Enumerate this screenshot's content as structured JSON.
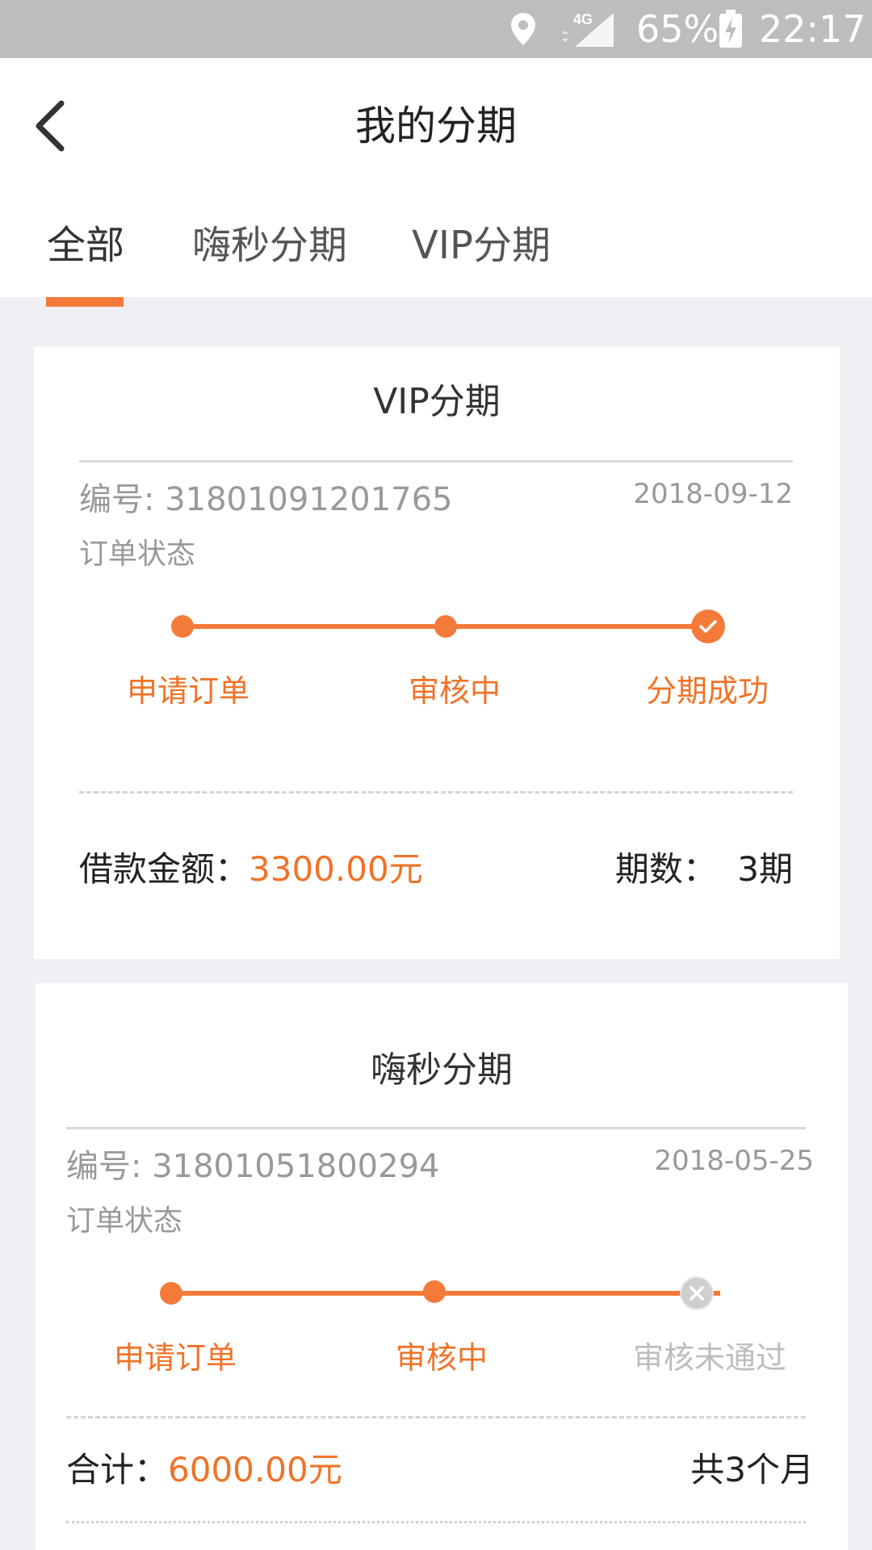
{
  "status_bar": {
    "battery_percent": "65%",
    "time": "22:17",
    "network_label": "4G",
    "icons": [
      "location-icon",
      "signal-4g-icon",
      "battery-charging-icon"
    ]
  },
  "header": {
    "title": "我的分期",
    "back_icon": "chevron-left-icon"
  },
  "tabs": [
    {
      "label": "全部",
      "active": true
    },
    {
      "label": "嗨秒分期",
      "active": false
    },
    {
      "label": "VIP分期",
      "active": false
    }
  ],
  "colors": {
    "accent": "#f47a3a",
    "accent_text": "#f07328",
    "muted": "#999999",
    "disabled": "#bdbdbd"
  },
  "orders": [
    {
      "title": "VIP分期",
      "number": "编号: 31801091201765",
      "date": "2018-09-12",
      "status_label": "订单状态",
      "steps": [
        {
          "label": "申请订单",
          "state": "done"
        },
        {
          "label": "审核中",
          "state": "done"
        },
        {
          "label": "分期成功",
          "state": "success"
        }
      ],
      "amount_label": "借款金额：",
      "amount_value": "3300.00元",
      "term_label": "期数：",
      "term_value": "3期"
    },
    {
      "title": "嗨秒分期",
      "number": "编号: 31801051800294",
      "date": "2018-05-25",
      "status_label": "订单状态",
      "steps": [
        {
          "label": "申请订单",
          "state": "done"
        },
        {
          "label": "审核中",
          "state": "done"
        },
        {
          "label": "审核未通过",
          "state": "rejected"
        }
      ],
      "amount_label": "合计：",
      "amount_value": "6000.00元",
      "term_text": "共3个月"
    }
  ]
}
